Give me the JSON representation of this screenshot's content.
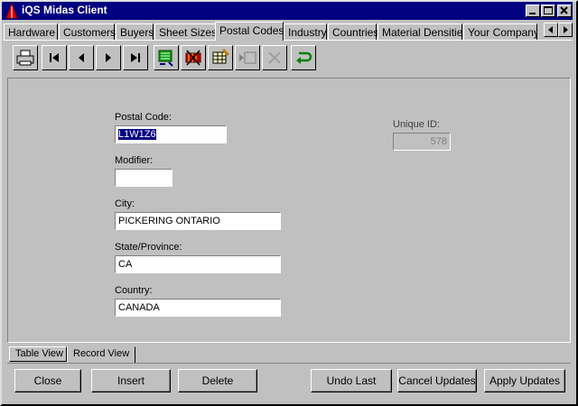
{
  "window": {
    "title": "iQS Midas Client"
  },
  "tabs": [
    {
      "label": "Hardware"
    },
    {
      "label": "Customers"
    },
    {
      "label": "Buyers"
    },
    {
      "label": "Sheet Sizes"
    },
    {
      "label": "Postal Codes"
    },
    {
      "label": "Industry"
    },
    {
      "label": "Countries"
    },
    {
      "label": "Material Densities"
    },
    {
      "label": "Your Company"
    }
  ],
  "toolbar": {
    "icons": [
      "printer-icon",
      "first-record-icon",
      "prior-record-icon",
      "next-record-icon",
      "last-record-icon",
      "post-icon",
      "delete-record-icon",
      "edit-icon",
      "insert-record-icon",
      "cancel-icon",
      "refresh-icon"
    ]
  },
  "form": {
    "postal_code": {
      "label": "Postal Code:",
      "value": "L1W1Z6"
    },
    "modifier": {
      "label": "Modifier:",
      "value": ""
    },
    "city": {
      "label": "City:",
      "value": "PICKERING ONTARIO"
    },
    "state": {
      "label": "State/Province:",
      "value": "CA"
    },
    "country": {
      "label": "Country:",
      "value": "CANADA"
    },
    "unique_id": {
      "label": "Unique ID:",
      "value": "578"
    }
  },
  "view_tabs": [
    {
      "label": "Table View"
    },
    {
      "label": "Record View"
    }
  ],
  "buttons": {
    "close": "Close",
    "insert": "Insert",
    "delete": "Delete",
    "undo_last": "Undo Last",
    "cancel_updates": "Cancel Updates",
    "apply_updates": "Apply Updates"
  }
}
